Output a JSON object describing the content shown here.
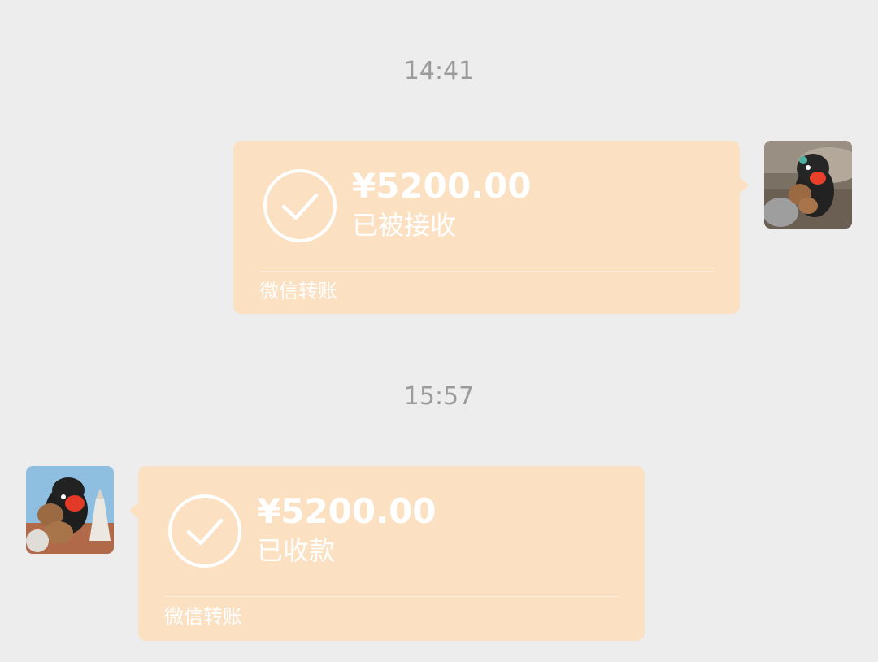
{
  "messages": [
    {
      "timestamp": "14:41",
      "amount": "¥5200.00",
      "status": "已被接收",
      "footer": "微信转账"
    },
    {
      "timestamp": "15:57",
      "amount": "¥5200.00",
      "status": "已收款",
      "footer": "微信转账"
    }
  ],
  "colors": {
    "background": "#ededed",
    "card": "#fbe0c2",
    "timestamp_text": "#9b9b9b",
    "card_text": "#ffffff"
  },
  "icons": {
    "check": "check-circle-icon"
  }
}
